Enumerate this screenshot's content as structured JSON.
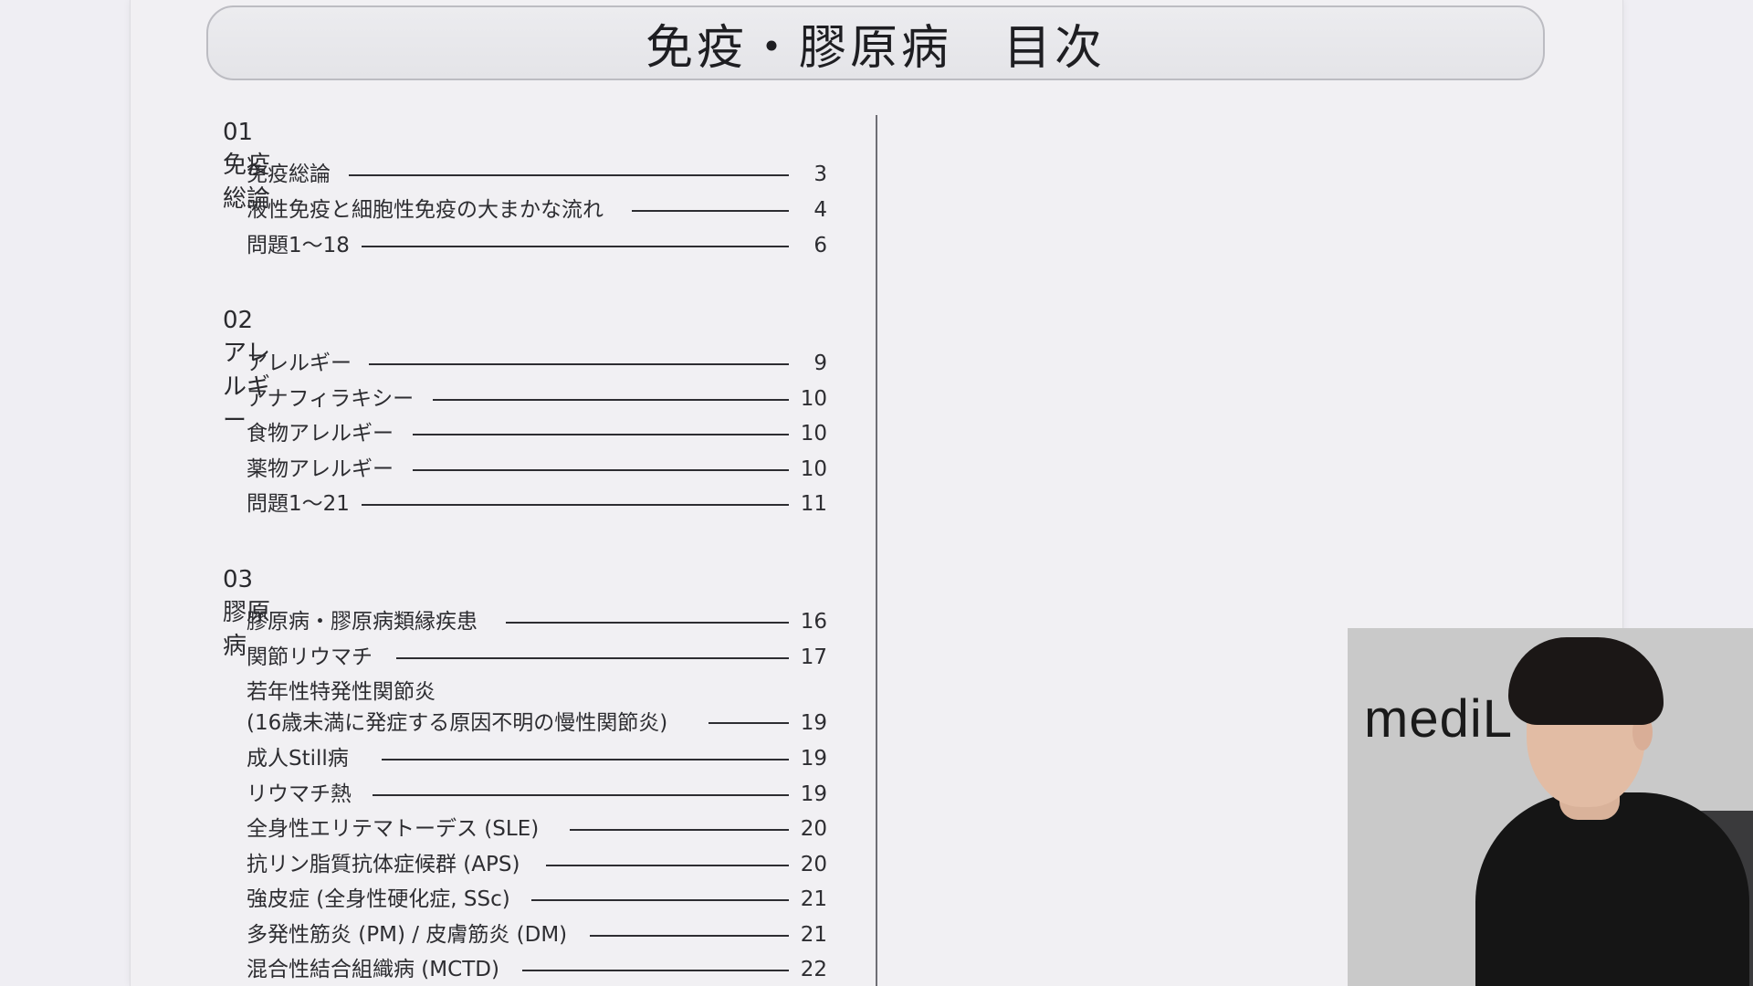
{
  "title": "免疫・膠原病　目次",
  "sections": [
    {
      "number": "01",
      "name": "免疫総論",
      "entries": [
        {
          "label": "免疫総論",
          "page": "3"
        },
        {
          "label": "液性免疫と細胞性免疫の大まかな流れ",
          "page": "4"
        },
        {
          "label": "問題1〜18",
          "page": "6"
        }
      ]
    },
    {
      "number": "02",
      "name": "アレルギー",
      "entries": [
        {
          "label": "アレルギー",
          "page": "9"
        },
        {
          "label": "アナフィラキシー",
          "page": "10"
        },
        {
          "label": "食物アレルギー",
          "page": "10"
        },
        {
          "label": "薬物アレルギー",
          "page": "10"
        },
        {
          "label": "問題1〜21",
          "page": "11"
        }
      ]
    },
    {
      "number": "03",
      "name": "膠原病",
      "entries": [
        {
          "label": "膠原病・膠原病類縁疾患",
          "page": "16"
        },
        {
          "label": "関節リウマチ",
          "page": "17"
        },
        {
          "label": "若年性特発性関節炎",
          "label2": "(16歳未満に発症する原因不明の慢性関節炎)",
          "page": "19"
        },
        {
          "label": "成人Still病",
          "page": "19"
        },
        {
          "label": "リウマチ熱",
          "page": "19"
        },
        {
          "label": "全身性エリテマトーデス (SLE)",
          "page": "20"
        },
        {
          "label": "抗リン脂質抗体症候群 (APS)",
          "page": "20"
        },
        {
          "label": "強皮症 (全身性硬化症, SSc)",
          "page": "21"
        },
        {
          "label": "多発性筋炎 (PM) / 皮膚筋炎 (DM)",
          "page": "21"
        },
        {
          "label": "混合性結合組織病 (MCTD)",
          "page": "22"
        }
      ]
    }
  ],
  "webcam": {
    "logo_text": "mediL",
    "logo_dot_color": "#c8202a"
  }
}
